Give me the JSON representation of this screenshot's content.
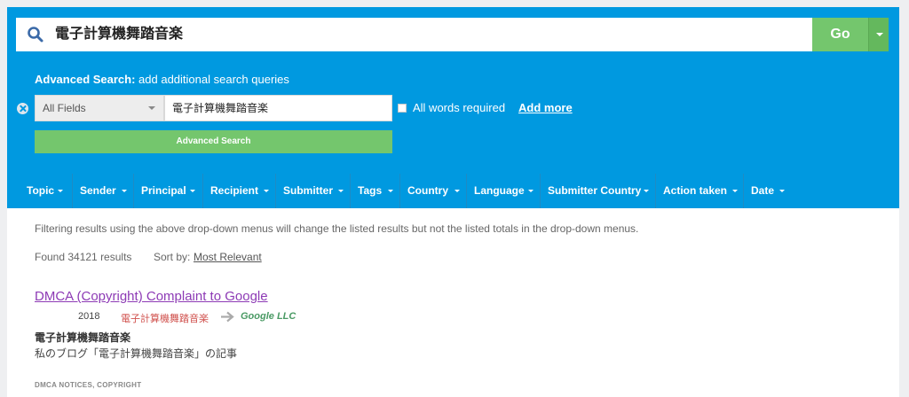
{
  "search": {
    "query": "電子計算機舞踏音楽",
    "go_label": "Go"
  },
  "advanced": {
    "title_bold": "Advanced Search:",
    "title_rest": " add additional search queries",
    "field_select": "All Fields",
    "field_value": "電子計算機舞踏音楽",
    "all_words_label": "All words required",
    "add_more_label": "Add more",
    "button_label": "Advanced Search"
  },
  "filters": [
    "Topic",
    "Sender",
    "Principal",
    "Recipient",
    "Submitter",
    "Tags",
    "Country",
    "Language",
    "Submitter Country",
    "Action taken",
    "Date"
  ],
  "results_info": {
    "note": "Filtering results using the above drop-down menus will change the listed results but not the listed totals in the drop-down menus.",
    "found": "Found 34121 results",
    "sort_label": "Sort by:",
    "sort_value": "Most Relevant"
  },
  "result": {
    "title": "DMCA (Copyright) Complaint to Google",
    "year": "2018",
    "sender": "電子計算機舞踏音楽",
    "recipient": "Google LLC",
    "name": "電子計算機舞踏音楽",
    "description": "私のブログ「電子計算機舞踏音楽」の記事",
    "tags": "DMCA NOTICES, COPYRIGHT"
  },
  "colors": {
    "header_blue": "#0099e0",
    "button_green": "#74c66d",
    "link_purple": "#8d3ab5",
    "sender_red": "#d0514d",
    "recipient_green": "#4a9a64"
  }
}
